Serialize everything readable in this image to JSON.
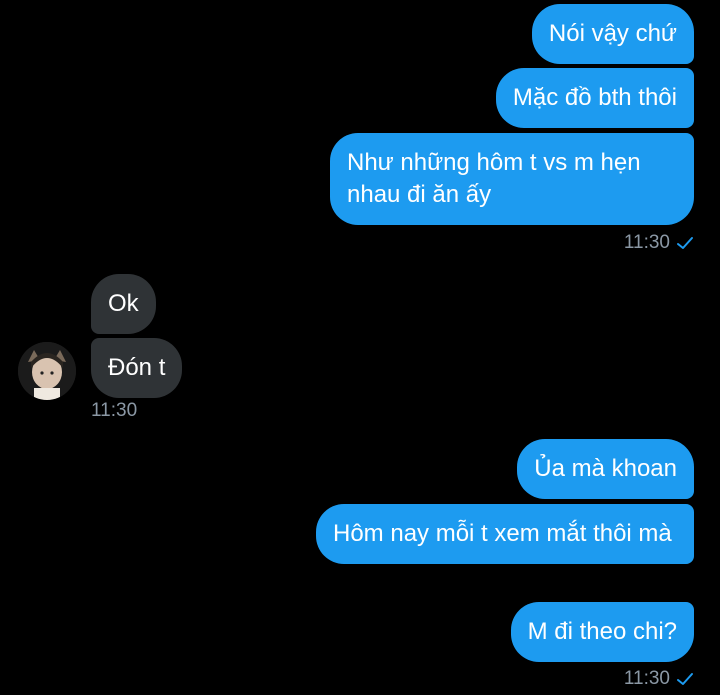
{
  "outgoing_top": [
    {
      "text": "Nói vậy chứ"
    },
    {
      "text": "Mặc đồ bth thôi"
    },
    {
      "text": "Như những hôm t vs m hẹn nhau đi ăn ấy"
    }
  ],
  "outgoing_top_time": "11:30",
  "incoming": [
    {
      "text": "Ok"
    },
    {
      "text": "Đón t"
    }
  ],
  "incoming_time": "11:30",
  "outgoing_bottom": [
    {
      "text": "Ủa mà khoan"
    },
    {
      "text": "Hôm nay mỗi t xem mắt thôi mà"
    },
    {
      "text": "M đi theo chi?"
    }
  ],
  "outgoing_bottom_time": "11:30",
  "colors": {
    "outgoing": "#1d9bf0",
    "incoming": "#2f3336",
    "background": "#000000",
    "meta": "#8b98a5"
  },
  "icons": {
    "read_receipt": "check-icon",
    "avatar": "user-avatar"
  }
}
